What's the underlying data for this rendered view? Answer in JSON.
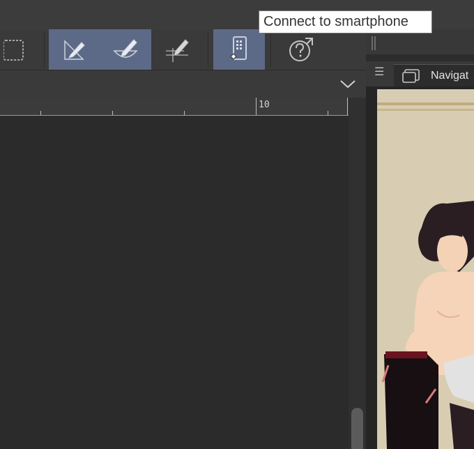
{
  "tooltip": {
    "text": "Connect to smartphone"
  },
  "toolbar": {
    "buttons": [
      {
        "name": "selection-tool-button",
        "icon": "selection-rectangle-icon",
        "active": false
      },
      {
        "name": "ruler-tool-button",
        "icon": "ruler-pen-icon",
        "active": true
      },
      {
        "name": "curve-ruler-button",
        "icon": "curve-ruler-pen-icon",
        "active": true
      },
      {
        "name": "perspective-ruler-button",
        "icon": "perspective-ruler-pen-icon",
        "active": false
      },
      {
        "name": "connect-smartphone-button",
        "icon": "smartphone-icon",
        "active": true
      },
      {
        "name": "help-button",
        "icon": "help-icon",
        "active": false
      }
    ]
  },
  "ruler": {
    "label": "10"
  },
  "navigator": {
    "tab_label": "Navigat",
    "menu_icon": "menu-icon"
  },
  "colors": {
    "active_button": "#5d6a87",
    "panel_bg": "#3a3a3a",
    "canvas_bg": "#2b2b2b",
    "illustration_bg": "#d8cdb2"
  }
}
